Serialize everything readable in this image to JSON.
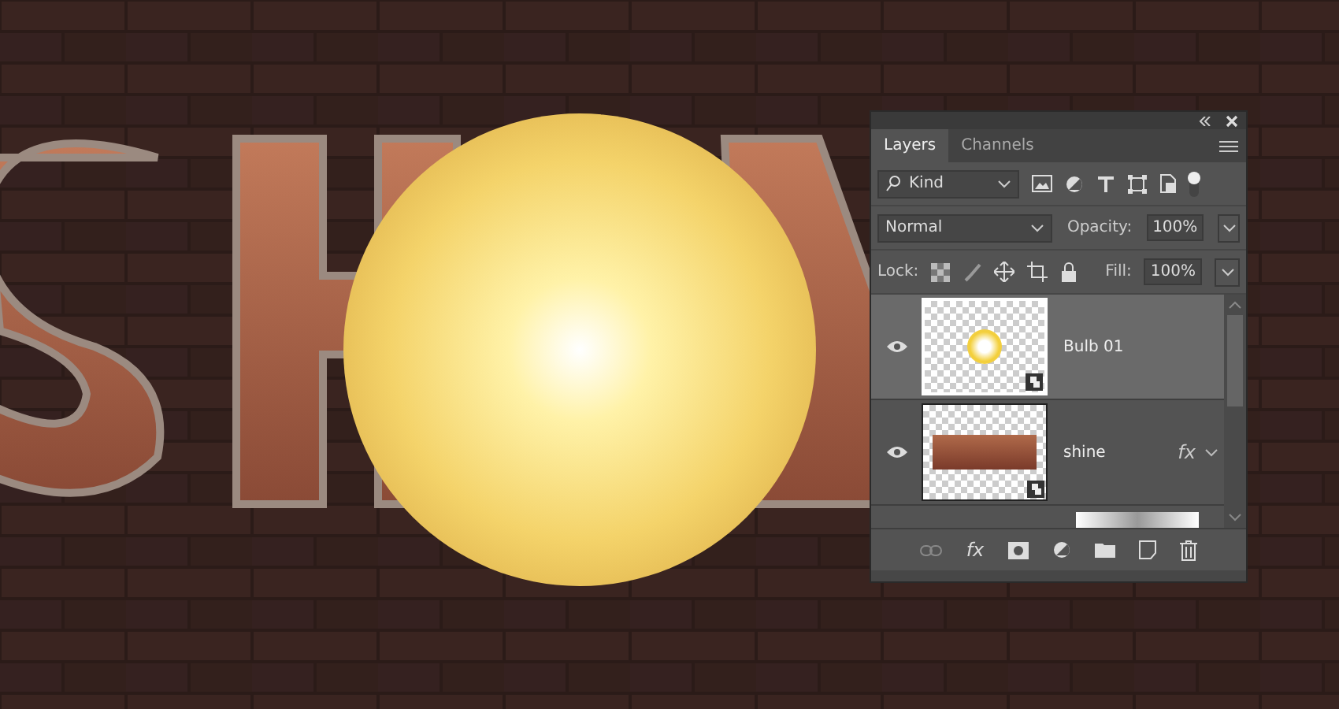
{
  "panel": {
    "tabs": [
      {
        "label": "Layers",
        "selected": true
      },
      {
        "label": "Channels",
        "selected": false
      }
    ],
    "filter": {
      "value": "Kind"
    },
    "blend_mode": {
      "value": "Normal"
    },
    "opacity": {
      "label": "Opacity:",
      "value": "100%"
    },
    "lock": {
      "label": "Lock:"
    },
    "fill": {
      "label": "Fill:",
      "value": "100%"
    },
    "layers": [
      {
        "name": "Bulb 01",
        "kind": "bulb",
        "visible": true,
        "selected": true
      },
      {
        "name": "shine",
        "kind": "text-art",
        "visible": true,
        "selected": false,
        "fx": "fx"
      }
    ],
    "footer_fx": "fx"
  }
}
